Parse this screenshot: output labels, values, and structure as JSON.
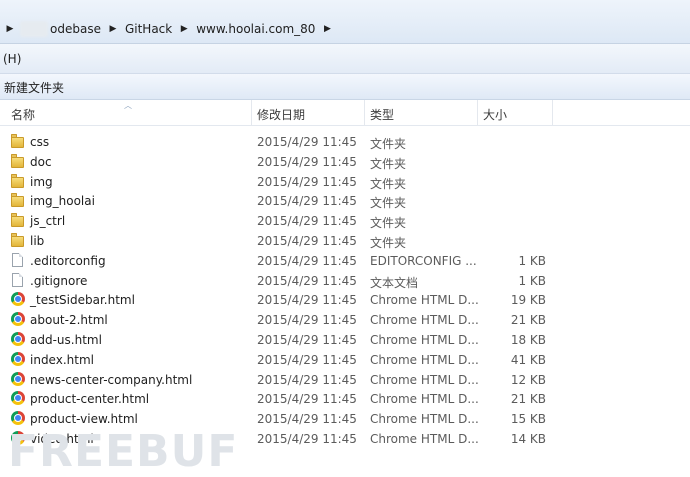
{
  "address_bar": {
    "crumbs": [
      "odebase",
      "GitHack",
      "www.hoolai.com_80"
    ]
  },
  "menu": {
    "item": "(H)"
  },
  "toolbar": {
    "new_folder_label": "新建文件夹"
  },
  "columns": {
    "name": "名称",
    "date": "修改日期",
    "type": "类型",
    "size": "大小"
  },
  "files": [
    {
      "name": "css",
      "date": "2015/4/29 11:45",
      "type": "文件夹",
      "size": "",
      "icon": "folder-icon"
    },
    {
      "name": "doc",
      "date": "2015/4/29 11:45",
      "type": "文件夹",
      "size": "",
      "icon": "folder-icon"
    },
    {
      "name": "img",
      "date": "2015/4/29 11:45",
      "type": "文件夹",
      "size": "",
      "icon": "folder-icon"
    },
    {
      "name": "img_hoolai",
      "date": "2015/4/29 11:45",
      "type": "文件夹",
      "size": "",
      "icon": "folder-icon"
    },
    {
      "name": "js_ctrl",
      "date": "2015/4/29 11:45",
      "type": "文件夹",
      "size": "",
      "icon": "folder-icon"
    },
    {
      "name": "lib",
      "date": "2015/4/29 11:45",
      "type": "文件夹",
      "size": "",
      "icon": "folder-icon"
    },
    {
      "name": ".editorconfig",
      "date": "2015/4/29 11:45",
      "type": "EDITORCONFIG ...",
      "size": "1 KB",
      "icon": "file-icon"
    },
    {
      "name": ".gitignore",
      "date": "2015/4/29 11:45",
      "type": "文本文档",
      "size": "1 KB",
      "icon": "text-file-icon"
    },
    {
      "name": "_testSidebar.html",
      "date": "2015/4/29 11:45",
      "type": "Chrome HTML D...",
      "size": "19 KB",
      "icon": "chrome-icon"
    },
    {
      "name": "about-2.html",
      "date": "2015/4/29 11:45",
      "type": "Chrome HTML D...",
      "size": "21 KB",
      "icon": "chrome-icon"
    },
    {
      "name": "add-us.html",
      "date": "2015/4/29 11:45",
      "type": "Chrome HTML D...",
      "size": "18 KB",
      "icon": "chrome-icon"
    },
    {
      "name": "index.html",
      "date": "2015/4/29 11:45",
      "type": "Chrome HTML D...",
      "size": "41 KB",
      "icon": "chrome-icon"
    },
    {
      "name": "news-center-company.html",
      "date": "2015/4/29 11:45",
      "type": "Chrome HTML D...",
      "size": "12 KB",
      "icon": "chrome-icon"
    },
    {
      "name": "product-center.html",
      "date": "2015/4/29 11:45",
      "type": "Chrome HTML D...",
      "size": "21 KB",
      "icon": "chrome-icon"
    },
    {
      "name": "product-view.html",
      "date": "2015/4/29 11:45",
      "type": "Chrome HTML D...",
      "size": "15 KB",
      "icon": "chrome-icon"
    },
    {
      "name": "video.html",
      "date": "2015/4/29 11:45",
      "type": "Chrome HTML D...",
      "size": "14 KB",
      "icon": "chrome-icon"
    }
  ],
  "watermark": "FREEBUF"
}
